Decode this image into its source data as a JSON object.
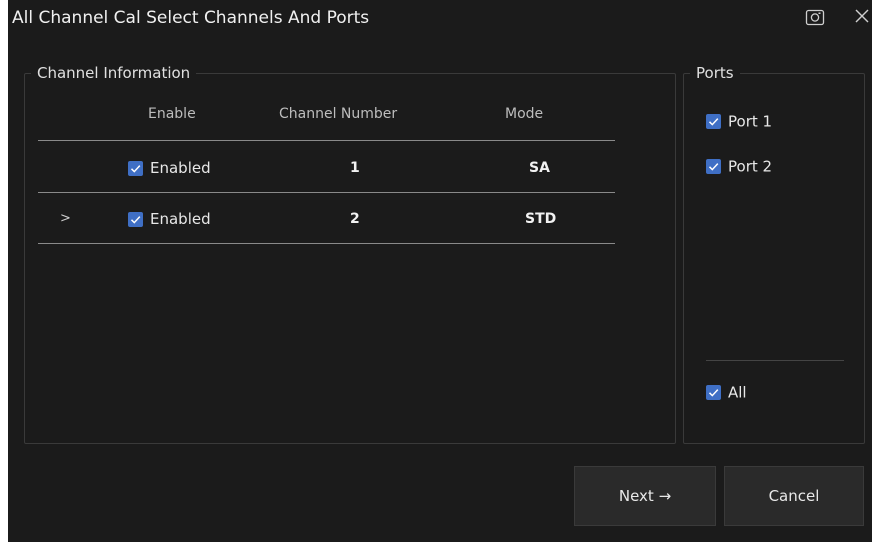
{
  "dialog": {
    "title": "All Channel Cal Select Channels And Ports",
    "camera_icon": "camera-icon",
    "close_icon": "close-icon"
  },
  "channel_info": {
    "legend": "Channel Information",
    "columns": [
      "Enable",
      "Channel Number",
      "Mode"
    ],
    "rows": [
      {
        "indicator": "",
        "enabled": true,
        "enabled_label": "Enabled",
        "channel_number": "1",
        "mode": "SA"
      },
      {
        "indicator": ">",
        "enabled": true,
        "enabled_label": "Enabled",
        "channel_number": "2",
        "mode": "STD"
      }
    ]
  },
  "ports": {
    "legend": "Ports",
    "items": [
      {
        "label": "Port 1",
        "checked": true
      },
      {
        "label": "Port 2",
        "checked": true
      }
    ],
    "all": {
      "label": "All",
      "checked": true
    }
  },
  "buttons": {
    "next_label": "Next →",
    "cancel_label": "Cancel"
  },
  "colors": {
    "background": "#1b1b1b",
    "checkbox": "#3f6fc5",
    "button": "#2a2a2a"
  }
}
